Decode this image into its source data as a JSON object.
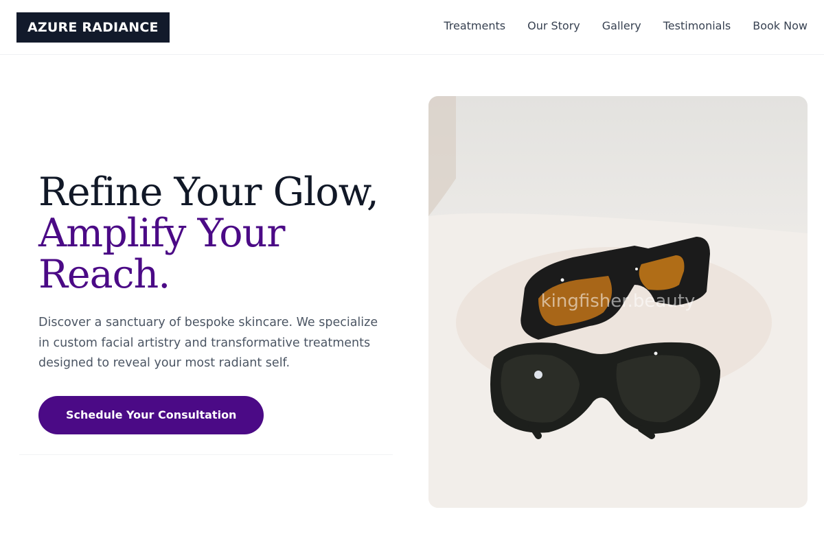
{
  "brand": {
    "name": "AZURE RADIANCE"
  },
  "nav": {
    "items": [
      {
        "label": "Treatments"
      },
      {
        "label": "Our Story"
      },
      {
        "label": "Gallery"
      },
      {
        "label": "Testimonials"
      },
      {
        "label": "Book Now"
      }
    ]
  },
  "hero": {
    "headline_line1": "Refine Your Glow,",
    "headline_accent": "Amplify Your Reach.",
    "description": "Discover a sanctuary of bespoke skincare. We specialize in custom facial artistry and transformative treatments designed to reveal your most radiant self.",
    "cta_label": "Schedule Your Consultation",
    "image": {
      "alt": "Two pairs of protective laser safety glasses on a white surface",
      "watermark": "kingfisher.beauty"
    }
  },
  "colors": {
    "accent": "#4b0a86",
    "logo_bg": "#121a2b",
    "text_dark": "#111827",
    "text_muted": "#4b5563"
  }
}
